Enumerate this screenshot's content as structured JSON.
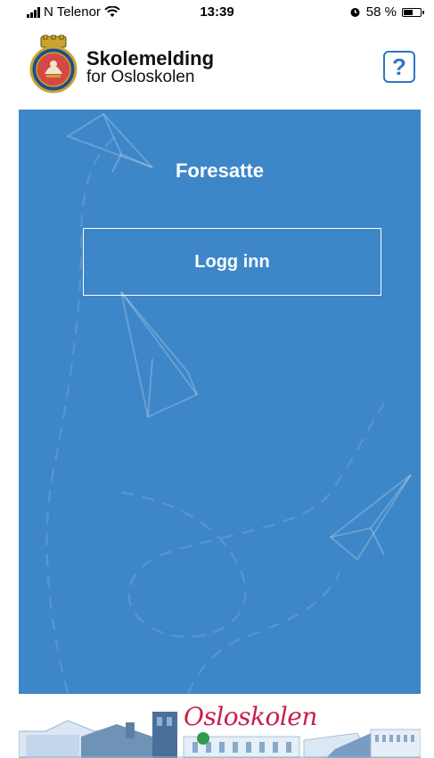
{
  "status_bar": {
    "carrier": "N Telenor",
    "time": "13:39",
    "battery_percent": "58 %",
    "battery_level": 0.58
  },
  "header": {
    "app_name": "Skolemelding",
    "app_subtitle": "for Osloskolen",
    "help_label": "?"
  },
  "panel": {
    "title": "Foresatte",
    "login_label": "Logg inn"
  },
  "footer": {
    "brand": "Osloskolen"
  },
  "colors": {
    "panel_blue": "#3d86c7",
    "accent_blue": "#2e77c2",
    "brand_red": "#c81e4a"
  }
}
